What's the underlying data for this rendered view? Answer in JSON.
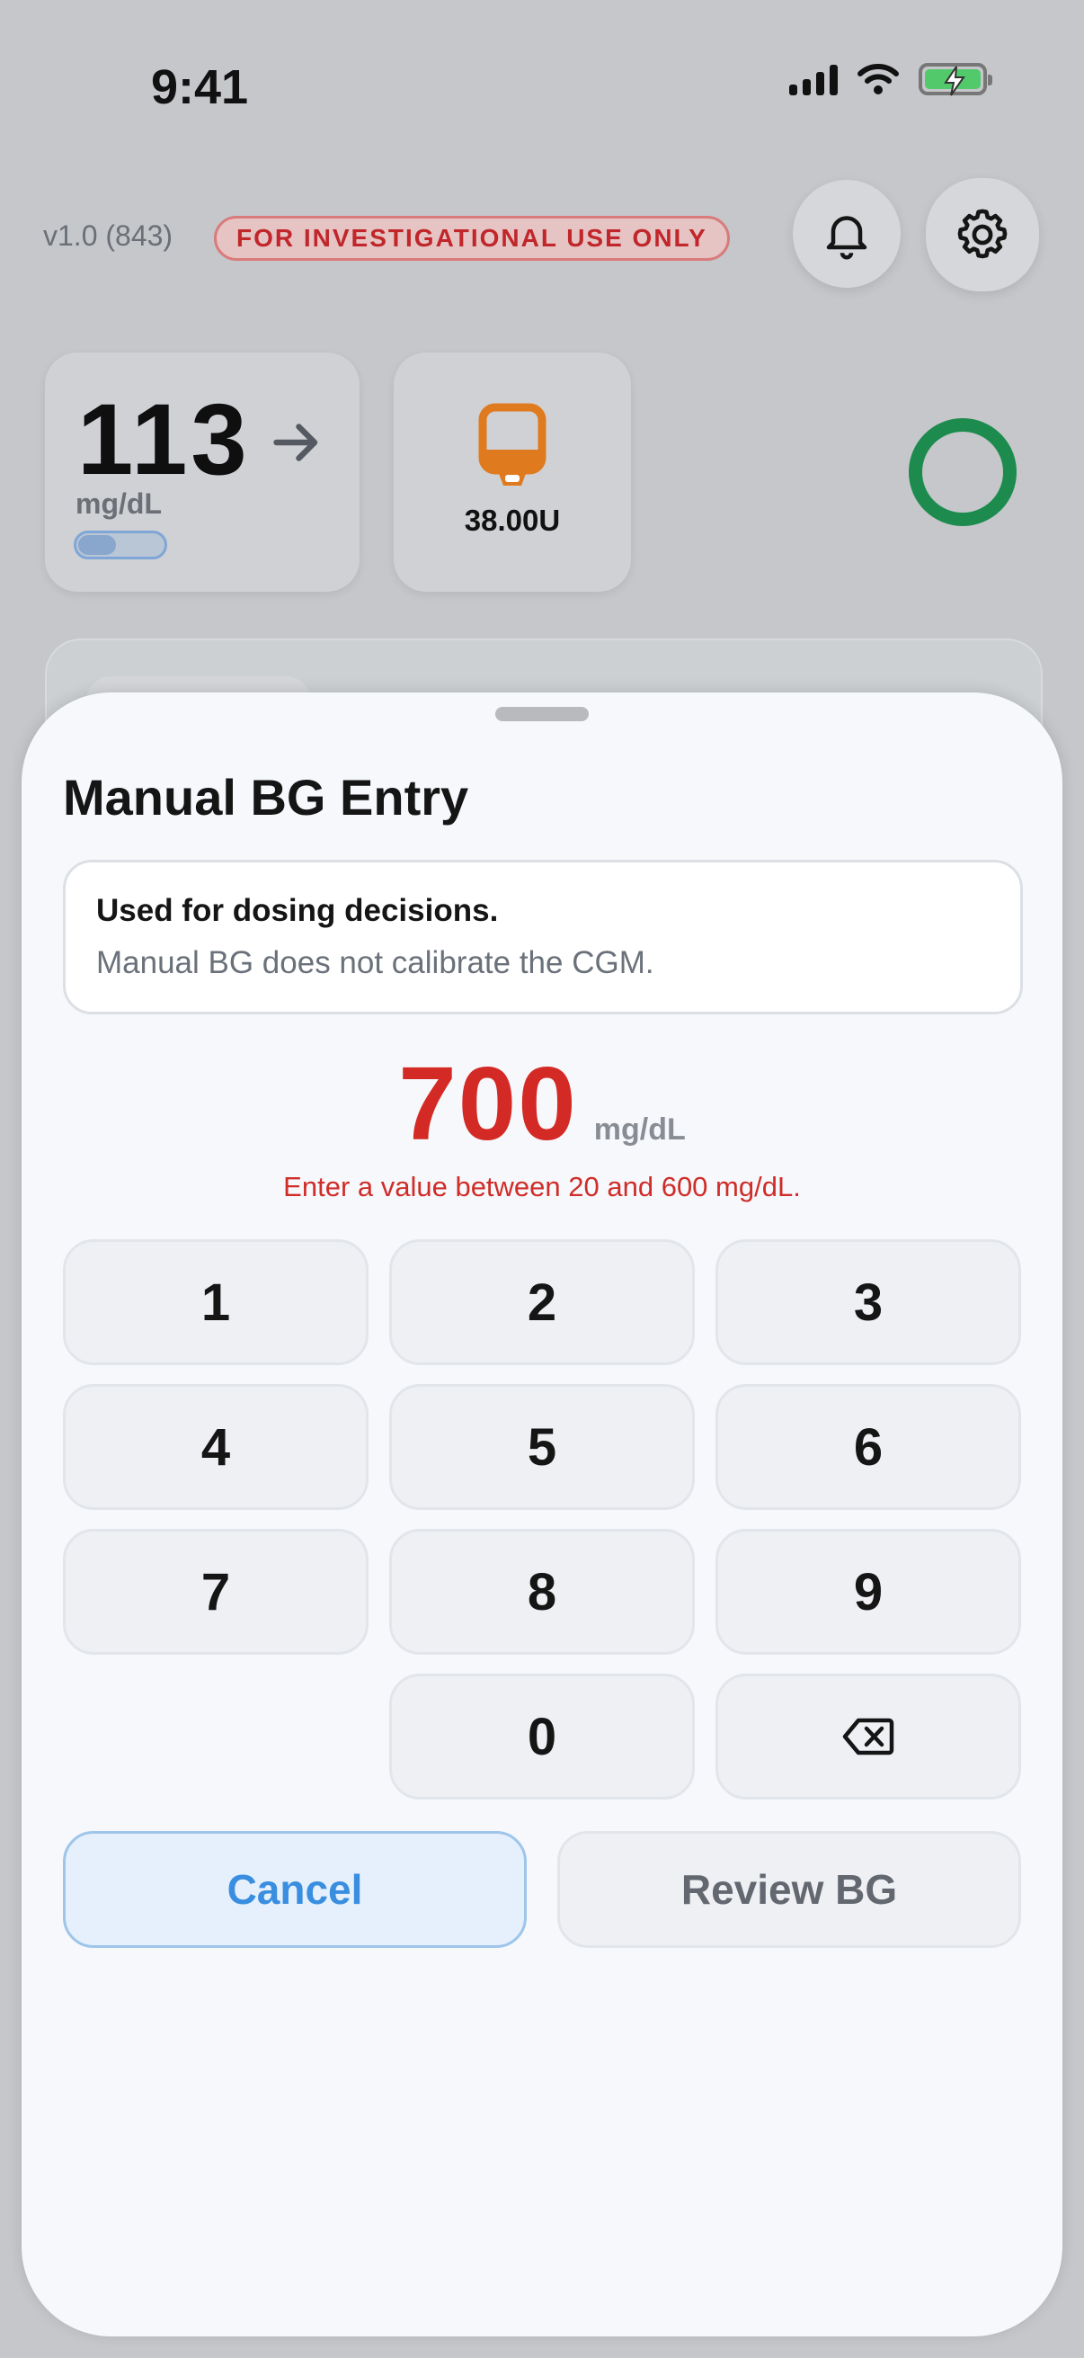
{
  "status_bar": {
    "time": "9:41"
  },
  "header": {
    "version": "v1.0 (843)",
    "badge": "FOR INVESTIGATIONAL USE ONLY",
    "icons": {
      "notifications": "bell-icon",
      "settings": "gear-icon"
    }
  },
  "glucose_card": {
    "value": "113",
    "unit": "mg/dL",
    "trend": "arrow-right-icon"
  },
  "pump_card": {
    "units": "38.00U",
    "icon": "insulin-reservoir-icon"
  },
  "loop_status": {
    "color": "#1d8b4d"
  },
  "sheet": {
    "title": "Manual BG Entry",
    "info": {
      "title": "Used for dosing decisions.",
      "subtitle": "Manual BG does not calibrate the CGM."
    },
    "entry": {
      "value": "700",
      "unit": "mg/dL"
    },
    "error": "Enter a value between 20 and 600 mg/dL.",
    "keypad": [
      "1",
      "2",
      "3",
      "4",
      "5",
      "6",
      "7",
      "8",
      "9",
      "0"
    ],
    "backspace_icon": "backspace-icon",
    "cancel_label": "Cancel",
    "review_label": "Review BG"
  },
  "colors": {
    "error": "#d42a25",
    "accent": "#3a8ee0",
    "badge_text": "#c0262a"
  }
}
